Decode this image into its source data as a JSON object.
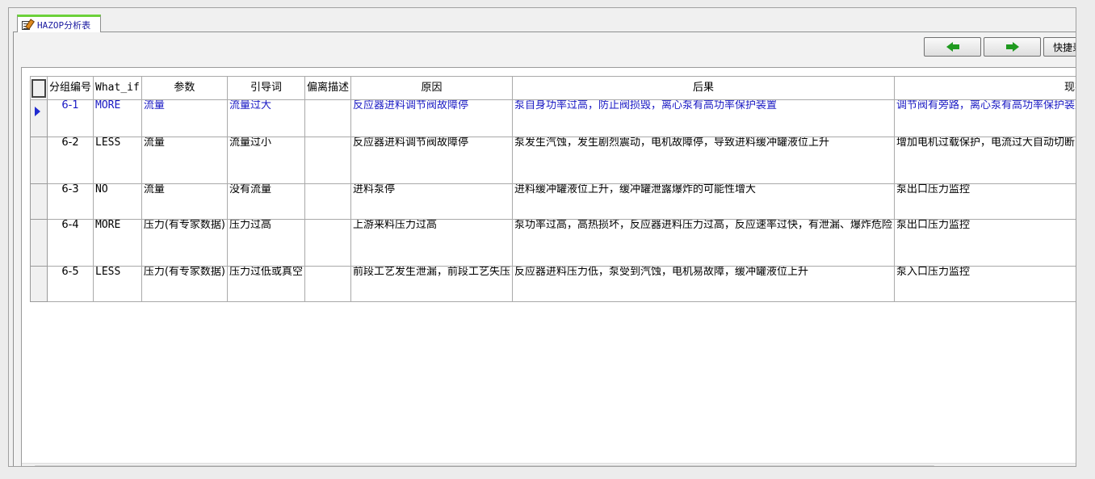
{
  "tab": {
    "title": "HAZOP分析表",
    "icon": "edit-document-icon"
  },
  "toolbar": {
    "prev_icon": "arrow-left-icon",
    "next_icon": "arrow-right-icon",
    "quick_label": "快捷录"
  },
  "table": {
    "columns": [
      "分组编号",
      "What_if",
      "参数",
      "引导词",
      "偏离描述",
      "原因",
      "后果",
      "现有措施"
    ],
    "rows": [
      {
        "code": "6-1",
        "what_if": "MORE",
        "param": "流量",
        "guide": "流量过大",
        "deviation": "",
        "cause": "反应器进料调节阀故障停",
        "consequence": "泵自身功率过高，防止阀损毁，离心泵有高功率保护装置",
        "measures": "调节阀有旁路，离心泵有高功率保护装置",
        "selected": true
      },
      {
        "code": "6-2",
        "what_if": "LESS",
        "param": "流量",
        "guide": "流量过小",
        "deviation": "",
        "cause": "反应器进料调节阀故障停",
        "consequence": "泵发生汽蚀，发生剧烈震动，电机故障停，导致进料缓冲罐液位上升",
        "measures": "增加电机过载保护，电流过大自动切断，增加上游液位控制，上游缓冲罐低限报警",
        "selected": false
      },
      {
        "code": "6-3",
        "what_if": "NO",
        "param": "流量",
        "guide": "没有流量",
        "deviation": "",
        "cause": "进料泵停",
        "consequence": "进料缓冲罐液位上升，缓冲罐泄露爆炸的可能性增大",
        "measures": "泵出口压力监控",
        "selected": false
      },
      {
        "code": "6-4",
        "what_if": "MORE",
        "param": "压力(有专家数据)",
        "guide": "压力过高",
        "deviation": "",
        "cause": "上游来料压力过高",
        "consequence": "泵功率过高，高热损坏，反应器进料压力过高，反应速率过快，有泄漏、爆炸危险",
        "measures": "泵出口压力监控",
        "selected": false
      },
      {
        "code": "6-5",
        "what_if": "LESS",
        "param": "压力(有专家数据)",
        "guide": "压力过低或真空",
        "deviation": "",
        "cause": "前段工艺发生泄漏，前段工艺失压",
        "consequence": "反应器进料压力低，泵受到汽蚀，电机易故障，缓冲罐液位上升",
        "measures": "泵入口压力监控",
        "selected": false
      }
    ]
  },
  "colors": {
    "selected_text": "#1a1ac4",
    "tab_accent": "#6cd13a",
    "arrow": "#1f9a1f"
  }
}
